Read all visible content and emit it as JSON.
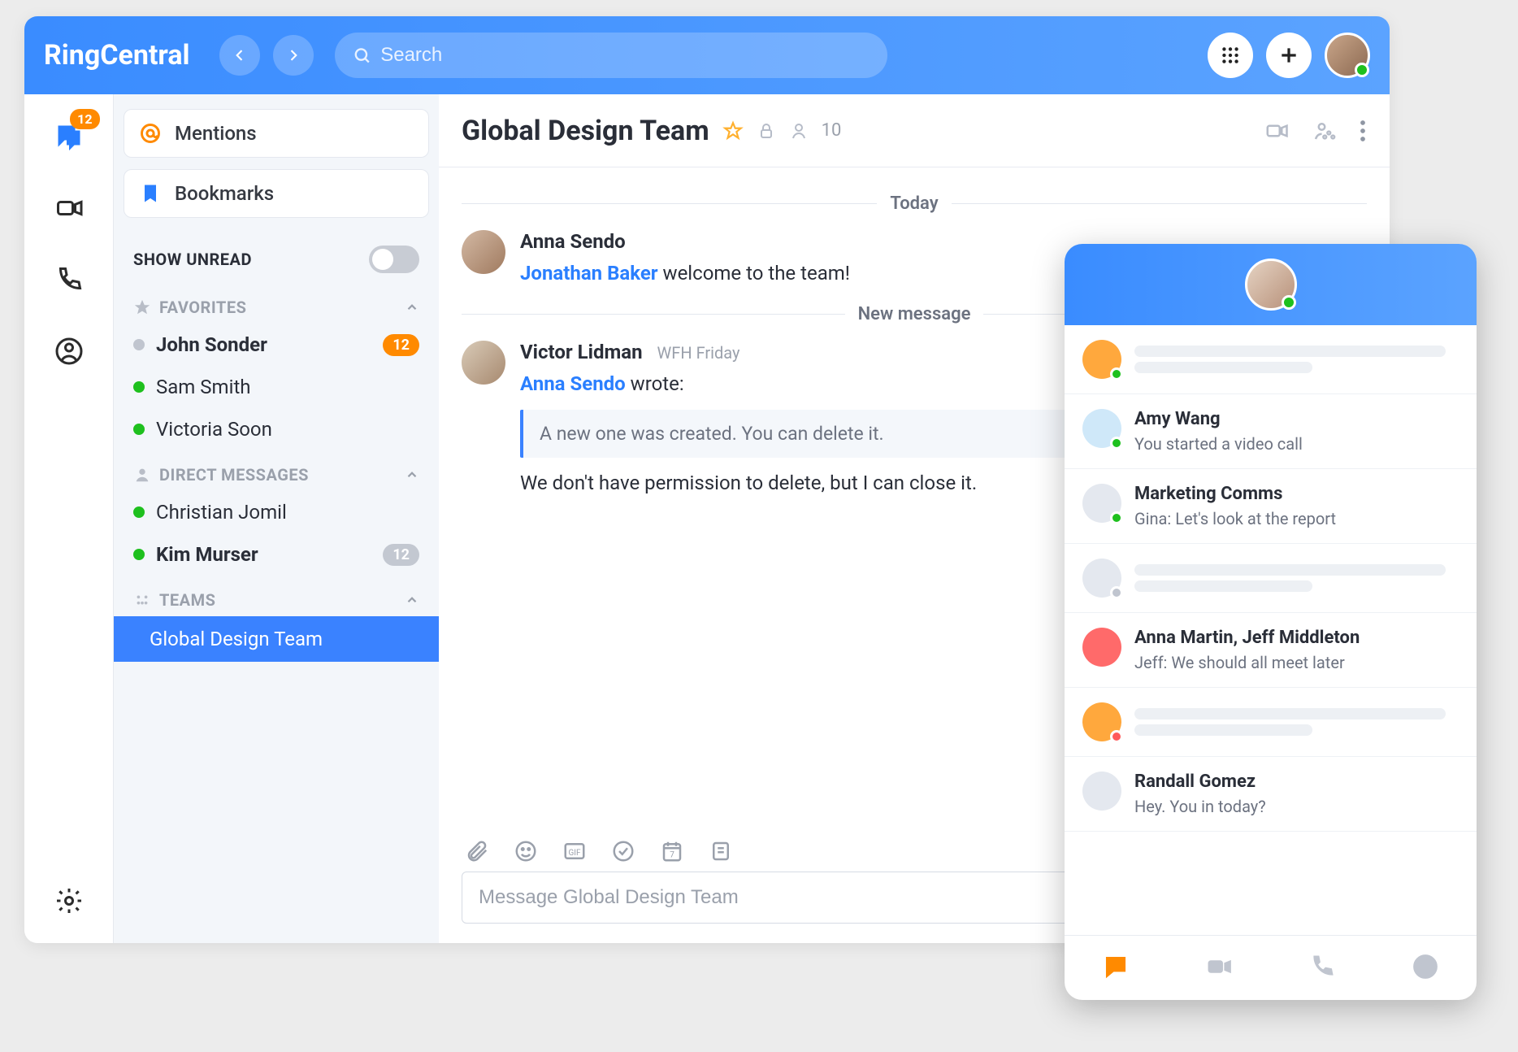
{
  "brand": "RingCentral",
  "header": {
    "search_placeholder": "Search"
  },
  "rail": {
    "messages_badge": "12"
  },
  "sidebar": {
    "mentions_label": "Mentions",
    "bookmarks_label": "Bookmarks",
    "show_unread_label": "SHOW UNREAD",
    "sections": {
      "favorites_label": "FAVORITES",
      "dm_label": "DIRECT MESSAGES",
      "teams_label": "TEAMS"
    },
    "favorites": [
      {
        "name": "John Sonder",
        "presence": "off",
        "bold": true,
        "badge": "12",
        "badge_color": "orange"
      },
      {
        "name": "Sam Smith",
        "presence": "on",
        "bold": false
      },
      {
        "name": "Victoria Soon",
        "presence": "on",
        "bold": false
      }
    ],
    "dms": [
      {
        "name": "Christian Jomil",
        "presence": "on",
        "bold": false
      },
      {
        "name": "Kim Murser",
        "presence": "on",
        "bold": true,
        "badge": "12",
        "badge_color": "gray"
      }
    ],
    "teams": [
      {
        "name": "Global Design Team",
        "selected": true
      }
    ]
  },
  "chat": {
    "title": "Global Design Team",
    "member_count": "10",
    "divider_today": "Today",
    "divider_new": "New message",
    "msg1": {
      "author": "Anna Sendo",
      "mention": "Jonathan Baker",
      "text": " welcome to the team!"
    },
    "msg2": {
      "author": "Victor Lidman",
      "subtitle": "WFH Friday",
      "quote_author": "Anna Sendo",
      "quote_wrote": " wrote:",
      "quote_body": "A new one was created. You can delete it.",
      "body": "We don't have permission to delete, but I can close it."
    },
    "composer_placeholder": "Message Global Design Team"
  },
  "mobile": {
    "rows": [
      {
        "skeleton": true,
        "color": "#ffa83d",
        "status": "#1ec01e"
      },
      {
        "title": "Amy Wang",
        "subtitle": "You started a video call",
        "color": "#cfe8f9",
        "status": "#1ec01e"
      },
      {
        "title": "Marketing Comms",
        "subtitle": "Gina: Let's look at the report",
        "color": "#e4e8ef",
        "status": "#1ec01e"
      },
      {
        "skeleton": true,
        "color": "#e4e8ef",
        "status": "#c0c5cf"
      },
      {
        "title": "Anna Martin, Jeff Middleton",
        "subtitle": "Jeff: We should all meet later",
        "color": "#ff6a6a",
        "status": null
      },
      {
        "skeleton": true,
        "color": "#ffa83d",
        "status": "#ff5a5a"
      },
      {
        "title": "Randall Gomez",
        "subtitle": "Hey. You in today?",
        "color": "#e4e8ef",
        "status": null
      }
    ]
  }
}
